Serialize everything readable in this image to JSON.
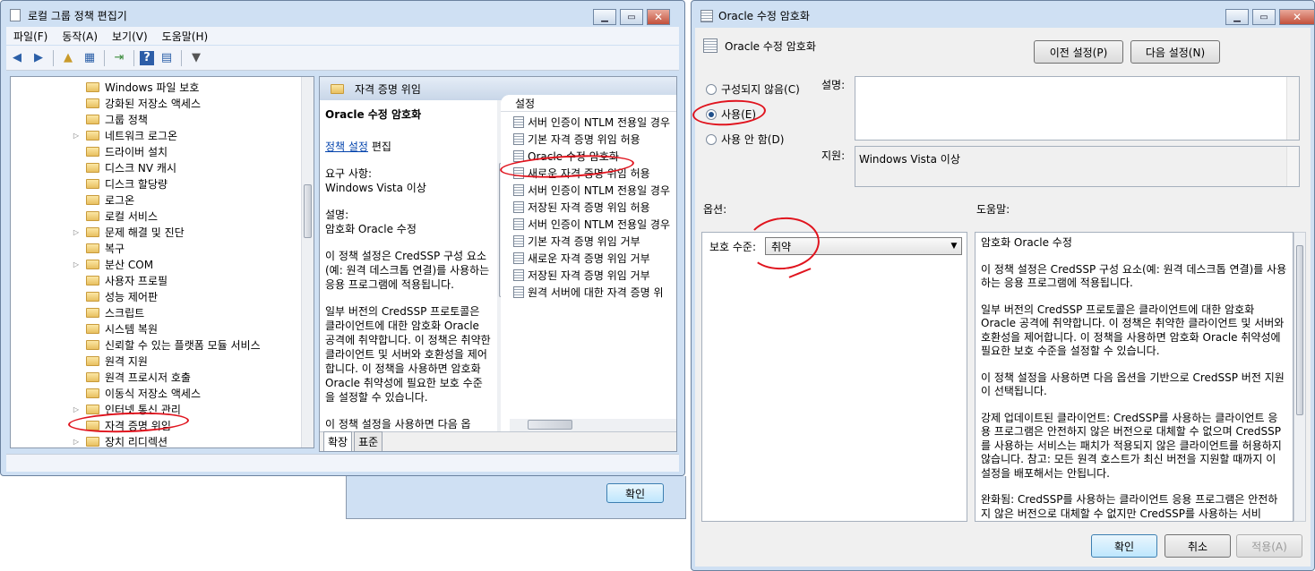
{
  "gpedit": {
    "title": "로컬 그룹 정책 편집기",
    "menu": [
      "파일(F)",
      "동작(A)",
      "보기(V)",
      "도움말(H)"
    ],
    "tree_items": [
      {
        "label": "Windows 파일 보호",
        "expand": false
      },
      {
        "label": "강화된 저장소 액세스",
        "expand": false
      },
      {
        "label": "그룹 정책",
        "expand": false
      },
      {
        "label": "네트워크 로그온",
        "expand": true
      },
      {
        "label": "드라이버 설치",
        "expand": false
      },
      {
        "label": "디스크 NV 캐시",
        "expand": false
      },
      {
        "label": "디스크 할당량",
        "expand": false
      },
      {
        "label": "로그온",
        "expand": false
      },
      {
        "label": "로컬 서비스",
        "expand": false
      },
      {
        "label": "문제 해결 및 진단",
        "expand": true
      },
      {
        "label": "복구",
        "expand": false
      },
      {
        "label": "분산 COM",
        "expand": true
      },
      {
        "label": "사용자 프로필",
        "expand": false
      },
      {
        "label": "성능 제어판",
        "expand": false
      },
      {
        "label": "스크립트",
        "expand": false
      },
      {
        "label": "시스템 복원",
        "expand": false
      },
      {
        "label": "신뢰할 수 있는 플랫폼 모듈 서비스",
        "expand": false
      },
      {
        "label": "원격 지원",
        "expand": false
      },
      {
        "label": "원격 프로시저 호출",
        "expand": false
      },
      {
        "label": "이동식 저장소 액세스",
        "expand": false
      },
      {
        "label": "인터넷 통신 관리",
        "expand": true
      },
      {
        "label": "자격 증명 위임",
        "expand": false
      },
      {
        "label": "장치 리디렉션",
        "expand": true
      }
    ],
    "folder_header": "자격 증명 위임",
    "ext_title": "Oracle 수정 암호화",
    "ext_link": "정책 설정",
    "ext_link_suffix": "편집",
    "ext_req_label": "요구 사항:",
    "ext_req_value": "Windows Vista 이상",
    "ext_desc_label": "설명:",
    "ext_desc_value": "암호화 Oracle 수정",
    "ext_para1": "이 정책 설정은 CredSSP 구성 요소(예: 원격 데스크톱 연결)를 사용하는 응용 프로그램에 적용됩니다.",
    "ext_para2": "일부 버전의 CredSSP 프로토콜은 클라이언트에 대한 암호화 Oracle 공격에 취약합니다.  이 정책은 취약한 클라이언트 및 서버와 호환성을 제어합니다.  이 정책을 사용하면 암호화 Oracle 취약성에 필요한 보호 수준을 설정할 수 있습니다.",
    "ext_para3": "이 정책 설정을 사용하면 다음 옵",
    "list_header": "설정",
    "list_items": [
      "서버 인증이 NTLM 전용일 경우",
      "기본 자격 증명 위임 허용",
      "Oracle 수정 암호화",
      "새로운 자격 증명 위임 허용",
      "서버 인증이 NTLM 전용일 경우",
      "저장된 자격 증명 위임 허용",
      "서버 인증이 NTLM 전용일 경우",
      "기본 자격 증명 위임 거부",
      "새로운 자격 증명 위임 거부",
      "저장된 자격 증명 위임 거부",
      "원격 서버에 대한 자격 증명 위"
    ],
    "tabs": [
      "확장",
      "표준"
    ],
    "behind_ok": "확인"
  },
  "dialog": {
    "title": "Oracle 수정 암호화",
    "subtitle": "Oracle 수정 암호화",
    "prev_button": "이전 설정(P)",
    "next_button": "다음 설정(N)",
    "radio_not_configured": "구성되지 않음(C)",
    "radio_enabled": "사용(E)",
    "radio_disabled": "사용 안 함(D)",
    "selected_radio": "enabled",
    "comment_label": "설명:",
    "supported_label": "지원:",
    "supported_value": "Windows Vista 이상",
    "options_label": "옵션:",
    "help_label": "도움말:",
    "protection_label": "보호 수준:",
    "protection_value": "취약",
    "help_text": [
      "암호화 Oracle 수정",
      "이 정책 설정은 CredSSP 구성 요소(예: 원격 데스크톱 연결)를 사용하는 응용 프로그램에 적용됩니다.",
      "일부 버전의 CredSSP 프로토콜은 클라이언트에 대한 암호화 Oracle 공격에 취약합니다.  이 정책은 취약한 클라이언트 및 서버와 호환성을 제어합니다.  이 정책을 사용하면 암호화 Oracle 취약성에 필요한 보호 수준을 설정할 수 있습니다.",
      "이 정책 설정을 사용하면 다음 옵션을 기반으로 CredSSP 버전 지원이 선택됩니다.",
      "강제 업데이트된 클라이언트: CredSSP를 사용하는 클라이언트 응용 프로그램은 안전하지 않은 버전으로 대체할 수 없으며 CredSSP를 사용하는 서비스는 패치가 적용되지 않은 클라이언트를 허용하지 않습니다. 참고: 모든 원격 호스트가 최신 버전을 지원할 때까지 이 설정을 배포해서는 안됩니다.",
      "완화됨: CredSSP를 사용하는 클라이언트 응용 프로그램은 안전하지 않은 버전으로 대체할 수 없지만 CredSSP를 사용하는 서비"
    ],
    "ok_button": "확인",
    "cancel_button": "취소",
    "apply_button": "적용(A)"
  }
}
